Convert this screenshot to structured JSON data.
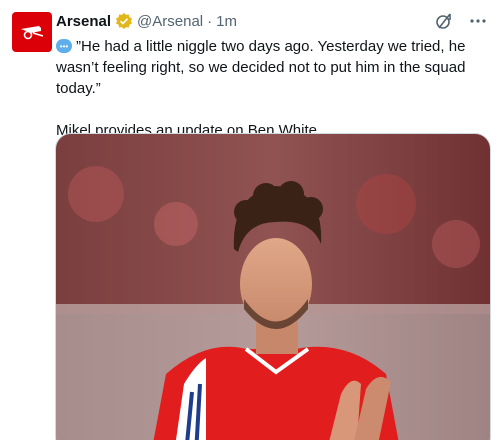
{
  "tweet": {
    "author_name": "Arsenal",
    "handle": "@Arsenal",
    "separator": "·",
    "time": "1m",
    "text_line1": "”He had a little niggle two days ago. Yesterday we tried, he wasn’t feeling right, so we decided not to put him in the squad today.”",
    "text_line2": "Mikel provides an update on Ben White."
  },
  "icons": {
    "avatar": "arsenal-logo",
    "verified": "verified-badge-icon",
    "grok": "grok-icon",
    "more": "more-icon",
    "quote": "speech-bubble-icon",
    "media": "player-photo"
  },
  "colors": {
    "arsenal_red": "#db0007",
    "verified_gold": "#e2b719",
    "secondary_text": "#536471"
  }
}
